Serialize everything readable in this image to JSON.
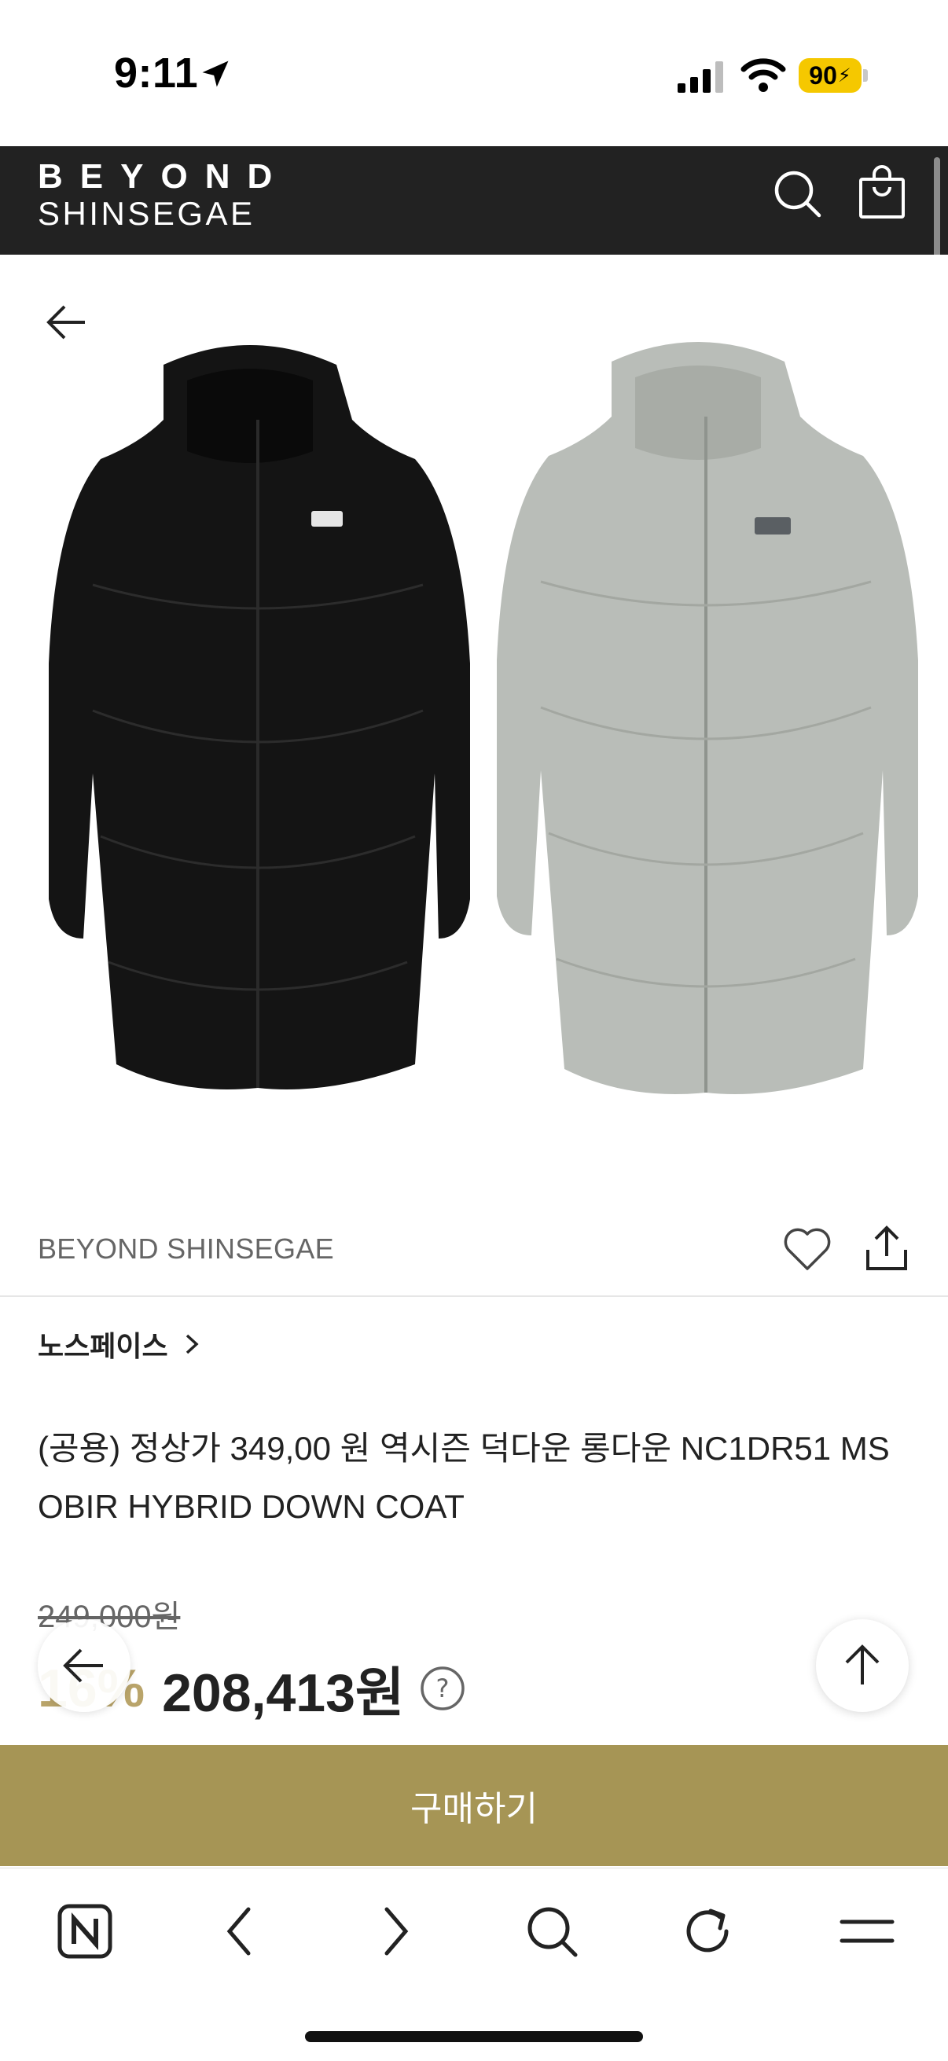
{
  "status_bar": {
    "time": "9:11",
    "battery": "90"
  },
  "header": {
    "logo_top": "BEYOND",
    "logo_bottom": "SHINSEGAE",
    "icons": [
      "search-icon",
      "shopping-bag-icon"
    ]
  },
  "product": {
    "images": [
      "black-down-coat",
      "gray-down-coat"
    ],
    "seller": "BEYOND SHINSEGAE",
    "brand": "노스페이스",
    "title": "(공용) 정상가 349,00 원 역시즌 덕다운 롱다운 NC1DR51 MS OBIR HYBRID DOWN COAT",
    "original_price": "249,000원",
    "discount": "16%",
    "sale_price": "208,413원"
  },
  "actions": {
    "buy_label": "구매하기"
  },
  "browser_toolbar": {
    "items": [
      "naver-home-icon",
      "back-icon",
      "forward-icon",
      "search-icon",
      "refresh-icon",
      "menu-icon"
    ]
  },
  "colors": {
    "header_bg": "#222222",
    "buy_button": "#a69555",
    "discount": "#b9a46a"
  }
}
